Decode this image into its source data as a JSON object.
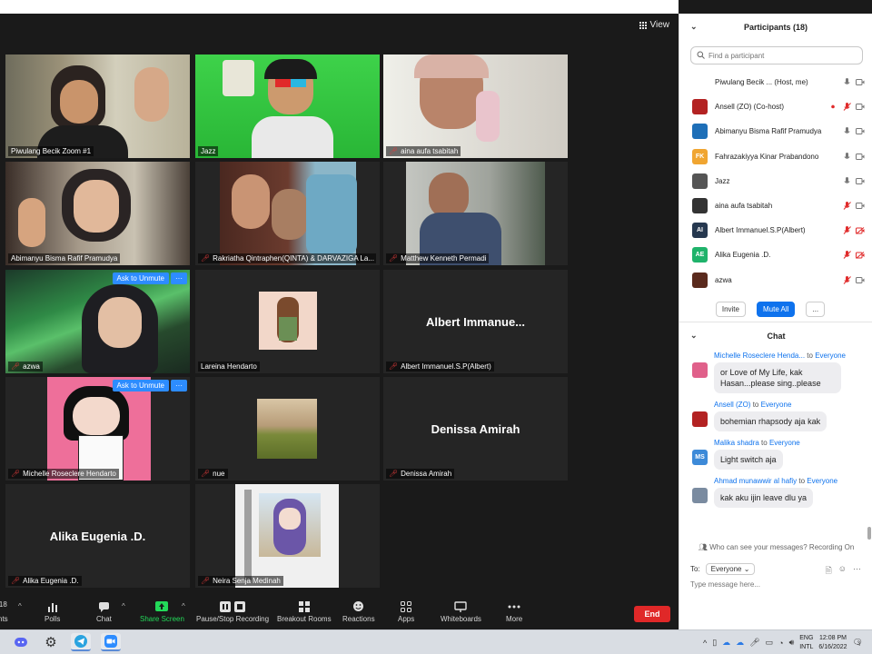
{
  "video": {
    "view_label": "View",
    "tiles": [
      {
        "name": "Piwulang Becik Zoom #1",
        "muted": false,
        "active": true,
        "kind": "video"
      },
      {
        "name": "Jazz",
        "muted": false,
        "kind": "video"
      },
      {
        "name": "aina aufa tsabitah",
        "muted": true,
        "kind": "video"
      },
      {
        "name": "Abimanyu Bisma Rafif Pramudya",
        "muted": false,
        "kind": "video"
      },
      {
        "name": "Rakriatha Qintraphen(QINTA) & DARVAZIGA La...",
        "muted": true,
        "kind": "video"
      },
      {
        "name": "Matthew Kenneth Permadi",
        "muted": true,
        "kind": "video"
      },
      {
        "name": "azwa",
        "muted": true,
        "kind": "video",
        "unmute": "Ask to Unmute"
      },
      {
        "name": "Lareina Hendarto",
        "muted": false,
        "kind": "image"
      },
      {
        "name": "Albert Immanuel.S.P(Albert)",
        "muted": true,
        "kind": "name",
        "display": "Albert  Immanue..."
      },
      {
        "name": "Michelle Roseclere Hendarto",
        "muted": true,
        "kind": "image",
        "unmute": "Ask to Unmute"
      },
      {
        "name": "nue",
        "muted": true,
        "kind": "image"
      },
      {
        "name": "Denissa Amirah",
        "muted": true,
        "kind": "name",
        "display": "Denissa Amirah"
      },
      {
        "name": "Alika Eugenia .D.",
        "muted": true,
        "kind": "name",
        "display": "Alika Eugenia .D."
      },
      {
        "name": "Neira Senja Medinah",
        "muted": true,
        "kind": "image"
      }
    ],
    "more_dots": "···"
  },
  "toolbar": {
    "left_cut_number": "18",
    "left_cut_label": "nts",
    "items": [
      {
        "label": "Polls",
        "icon": "polls-icon"
      },
      {
        "label": "Chat",
        "icon": "chat-icon"
      },
      {
        "label": "Share Screen",
        "icon": "share-screen-icon"
      },
      {
        "label": "Pause/Stop Recording",
        "icon": "recording-icon"
      },
      {
        "label": "Breakout Rooms",
        "icon": "breakout-rooms-icon"
      },
      {
        "label": "Reactions",
        "icon": "reactions-icon"
      },
      {
        "label": "Apps",
        "icon": "apps-icon"
      },
      {
        "label": "Whiteboards",
        "icon": "whiteboards-icon"
      },
      {
        "label": "More",
        "icon": "more-icon"
      }
    ],
    "end_label": "End"
  },
  "participants": {
    "title": "Participants (18)",
    "search_placeholder": "Find a participant",
    "list": [
      {
        "name": "Piwulang Becik ... (Host, me)",
        "avatar": "",
        "avatar_color": "#ffffff",
        "mic": "on",
        "cam": "on"
      },
      {
        "name": "Ansell (ZO) (Co-host)",
        "avatar": "",
        "avatar_color": "#b32222",
        "mic": "off",
        "cam": "on",
        "rec": true
      },
      {
        "name": "Abimanyu Bisma Rafif Pramudya",
        "avatar": "",
        "avatar_color": "#1e6fb8",
        "mic": "on",
        "cam": "on"
      },
      {
        "name": "Fahrazakiyya Kinar Prabandono",
        "avatar": "FK",
        "avatar_color": "#f0a531",
        "mic": "on",
        "cam": "on"
      },
      {
        "name": "Jazz",
        "avatar": "",
        "avatar_color": "#555555",
        "mic": "on",
        "cam": "on"
      },
      {
        "name": "aina aufa tsabitah",
        "avatar": "",
        "avatar_color": "#333333",
        "mic": "off",
        "cam": "on"
      },
      {
        "name": "Albert Immanuel.S.P(Albert)",
        "avatar": "AI",
        "avatar_color": "#26384f",
        "mic": "off",
        "cam": "off"
      },
      {
        "name": "Alika Eugenia .D.",
        "avatar": "AE",
        "avatar_color": "#1fb36b",
        "mic": "off",
        "cam": "off"
      },
      {
        "name": "azwa",
        "avatar": "",
        "avatar_color": "#5a2a1d",
        "mic": "off",
        "cam": "on"
      }
    ],
    "invite_label": "Invite",
    "mute_all_label": "Mute All",
    "more_label": "..."
  },
  "chat": {
    "title": "Chat",
    "messages": [
      {
        "from": "Michelle Roseclere Henda...",
        "to_word": "to",
        "to": "Everyone",
        "text": "or Love of My Life, kak Hasan...please sing..please",
        "avatar": "",
        "avatar_color": "#e0608a"
      },
      {
        "from": "Ansell (ZO)",
        "to_word": "to",
        "to": "Everyone",
        "text": "bohemian rhapsody aja kak",
        "avatar": "",
        "avatar_color": "#b32222"
      },
      {
        "from": "Malika shadra",
        "to_word": "to",
        "to": "Everyone",
        "text": "Light switch aja",
        "avatar": "MS",
        "avatar_color": "#3d8ad8"
      },
      {
        "from": "Ahmad munawwir al hafiy",
        "to_word": "to",
        "to": "Everyone",
        "text": "kak aku ijin leave dlu ya",
        "avatar": "",
        "avatar_color": "#7a8ba0"
      }
    ],
    "note": "Who can see your messages? Recording On",
    "to_label": "To:",
    "to_value": "Everyone",
    "input_placeholder": "Type message here..."
  },
  "taskbar": {
    "lang_top": "ENG",
    "lang_bottom": "INTL",
    "time": "12:08 PM",
    "date": "6/16/2022",
    "notif_count": "3"
  }
}
